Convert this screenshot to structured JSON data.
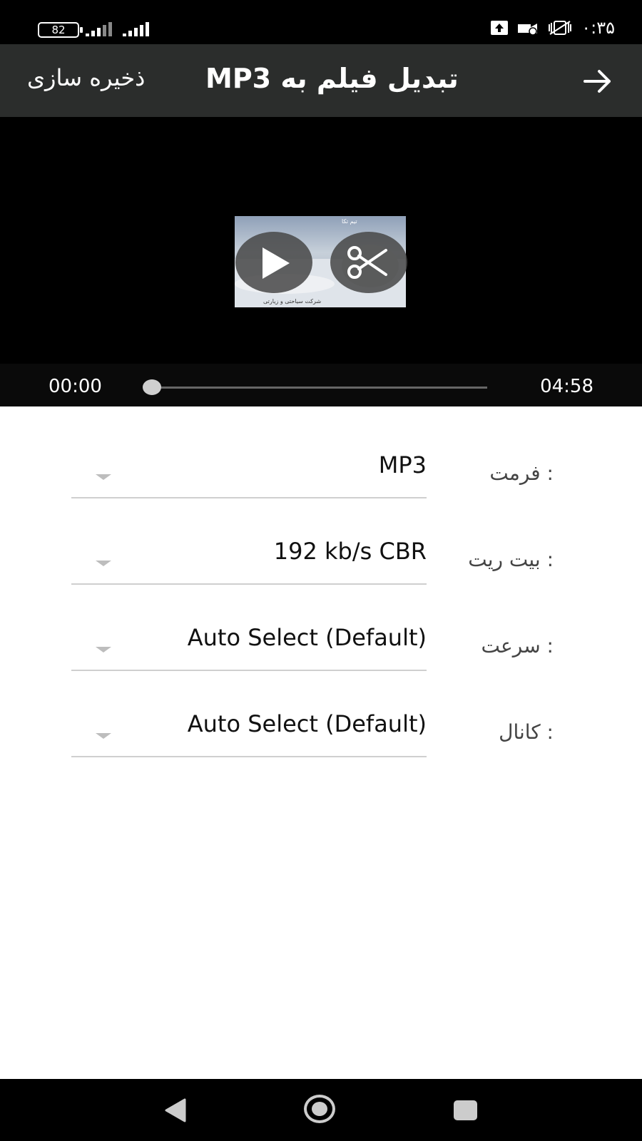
{
  "status_bar": {
    "battery_level": "82",
    "time": "۰:۳۵"
  },
  "toolbar": {
    "title": "تبدیل فیلم به MP3",
    "save_label": "ذخیره سازی"
  },
  "player": {
    "current_time": "00:00",
    "duration": "04:58",
    "progress_fraction": 0.0
  },
  "settings": [
    {
      "label": ": فرمت",
      "value": "MP3"
    },
    {
      "label": ": بیت ریت",
      "value": "192 kb/s CBR"
    },
    {
      "label": ": سرعت",
      "value": "Auto Select (Default)"
    },
    {
      "label": ": کانال",
      "value": "Auto Select (Default)"
    }
  ]
}
